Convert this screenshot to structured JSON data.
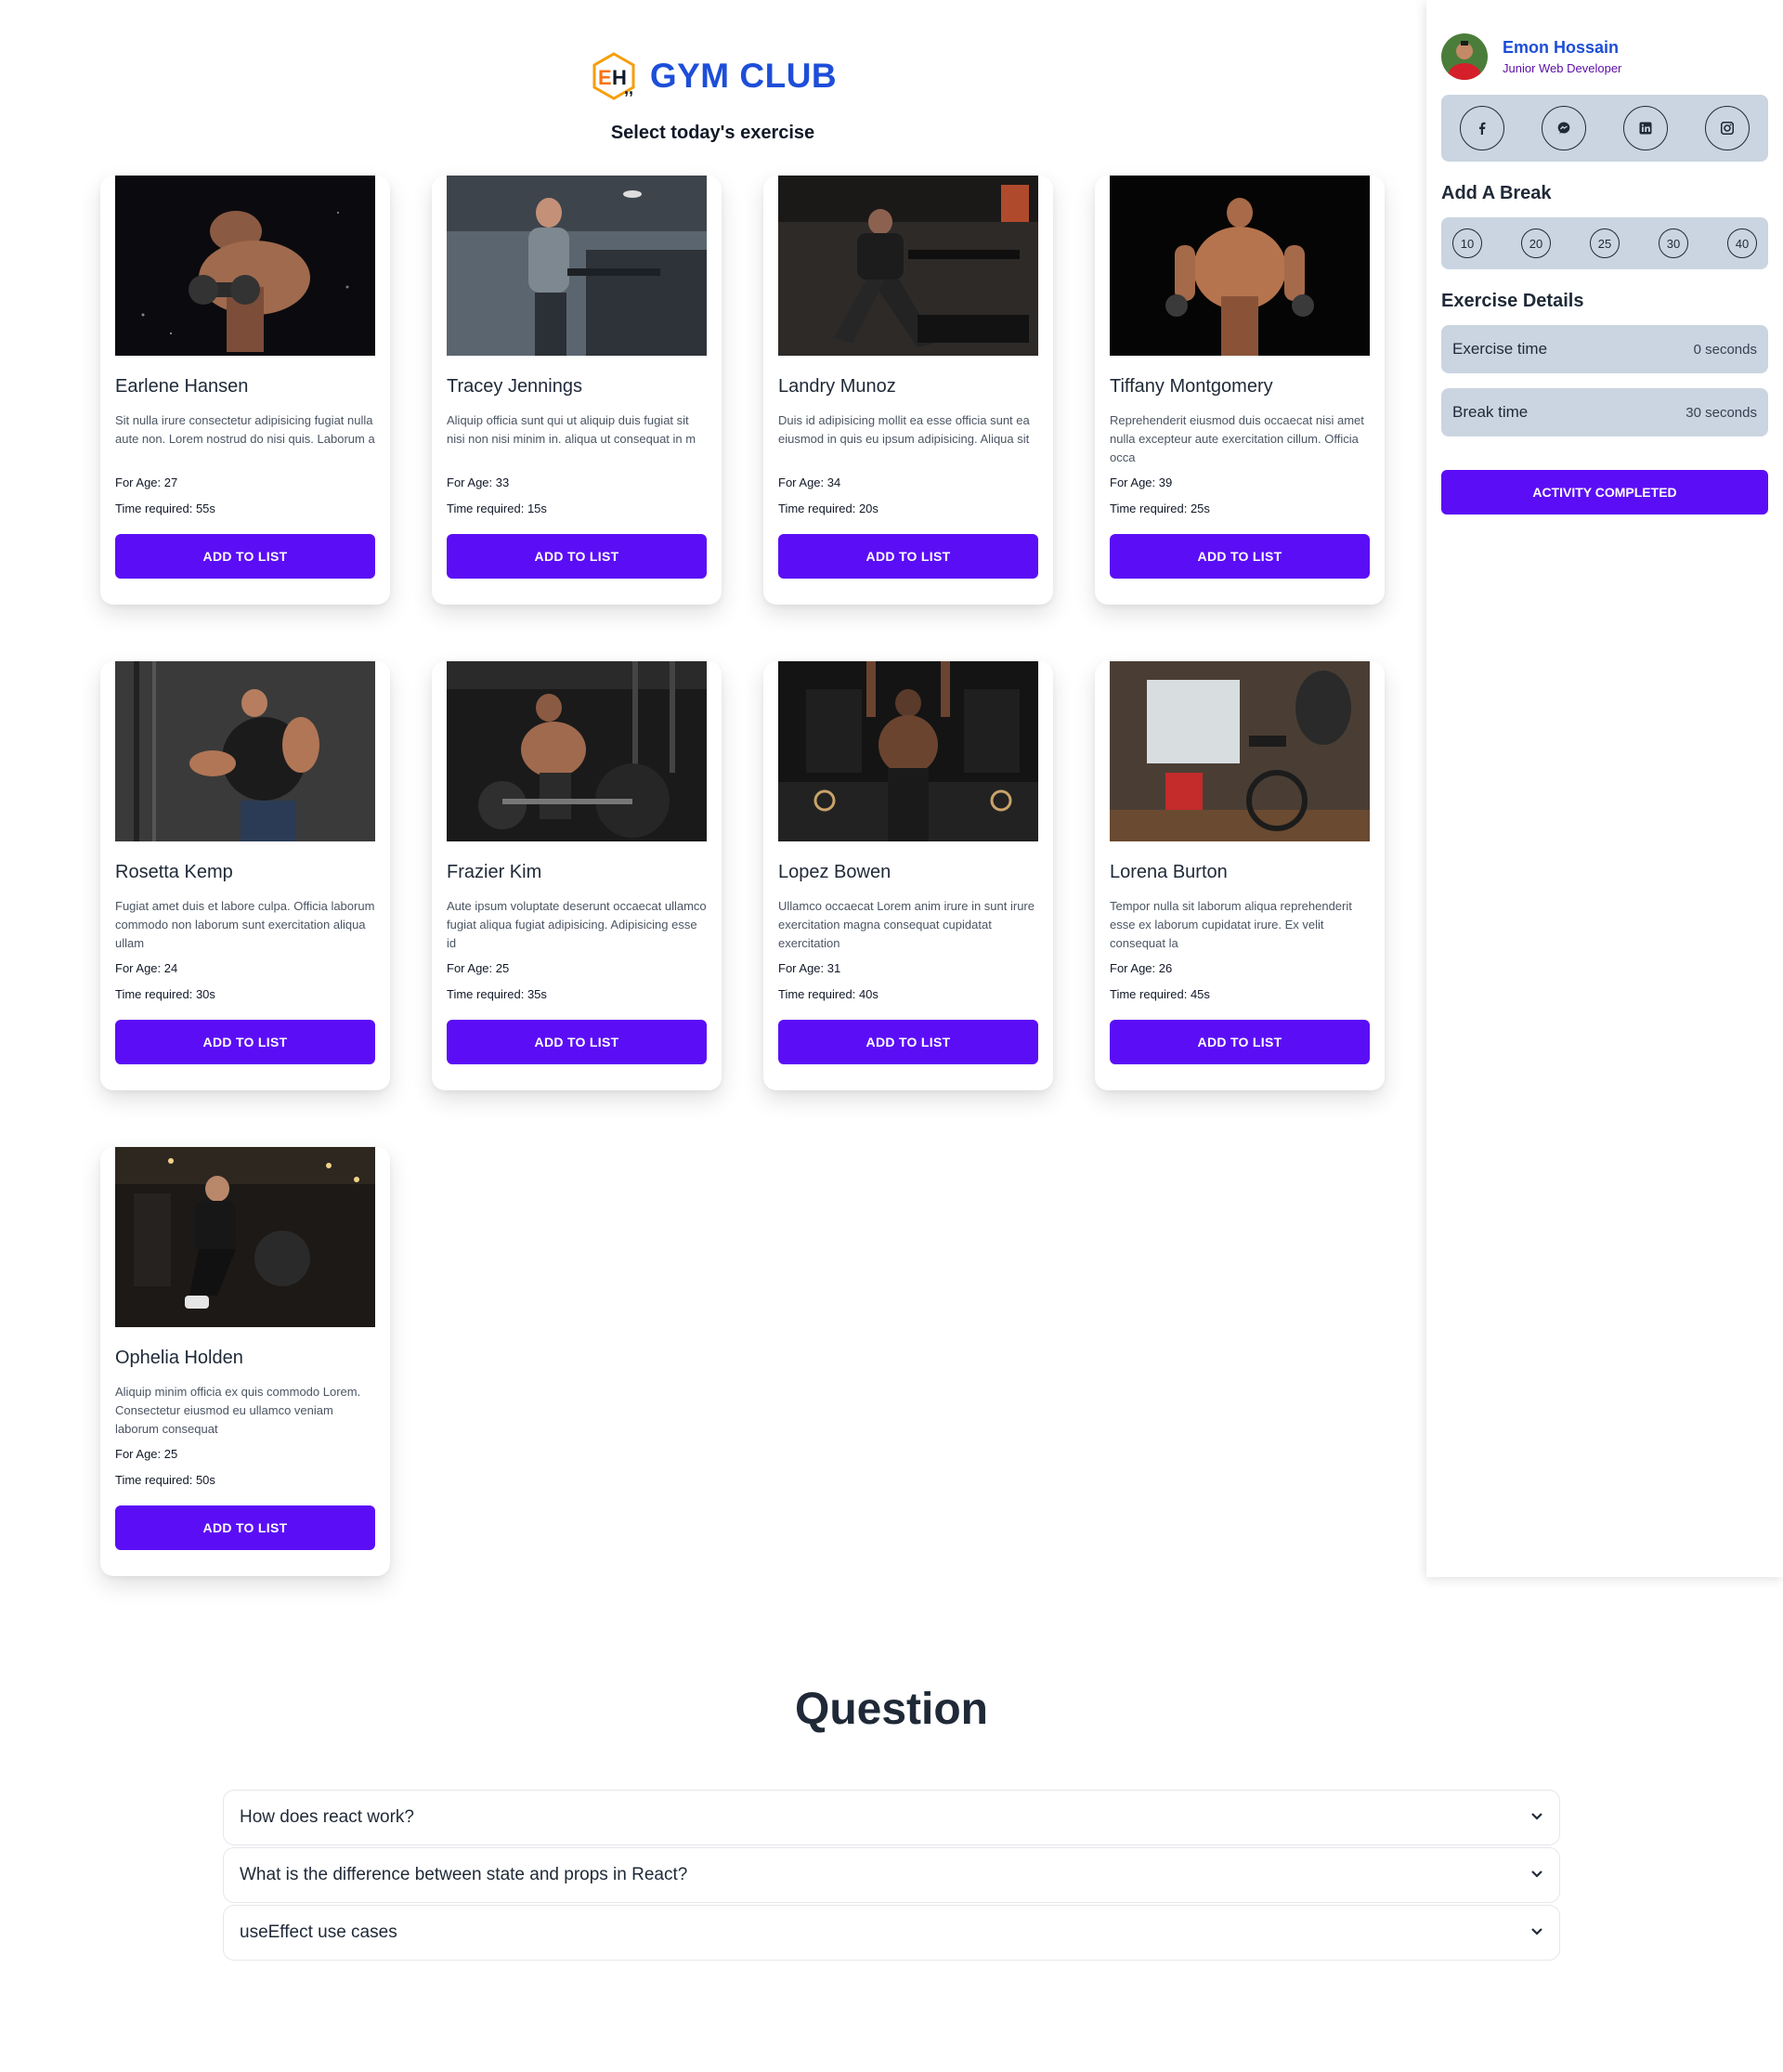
{
  "header": {
    "logo_text": "EH",
    "brand": "GYM CLUB",
    "subtitle": "Select today's exercise"
  },
  "cards": [
    {
      "name": "Earlene Hansen",
      "desc": "Sit nulla irure consectetur adipisicing fugiat nulla aute non. Lorem nostrud do nisi quis. Laborum a",
      "age": "For Age: 27",
      "time": "Time required: 55s",
      "button": "ADD TO LIST"
    },
    {
      "name": "Tracey Jennings",
      "desc": "Aliquip officia sunt qui ut aliquip duis fugiat sit nisi non nisi minim in. aliqua ut consequat in m",
      "age": "For Age: 33",
      "time": "Time required: 15s",
      "button": "ADD TO LIST"
    },
    {
      "name": "Landry Munoz",
      "desc": "Duis id adipisicing mollit ea esse officia sunt ea eiusmod in quis eu ipsum adipisicing. Aliqua sit",
      "age": "For Age: 34",
      "time": "Time required: 20s",
      "button": "ADD TO LIST"
    },
    {
      "name": "Tiffany Montgomery",
      "desc": "Reprehenderit eiusmod duis occaecat nisi amet nulla excepteur aute exercitation cillum. Officia occa",
      "age": "For Age: 39",
      "time": "Time required: 25s",
      "button": "ADD TO LIST"
    },
    {
      "name": "Rosetta Kemp",
      "desc": "Fugiat amet duis et labore culpa. Officia laborum commodo non laborum sunt exercitation aliqua ullam",
      "age": "For Age: 24",
      "time": "Time required: 30s",
      "button": "ADD TO LIST"
    },
    {
      "name": "Frazier Kim",
      "desc": "Aute ipsum voluptate deserunt occaecat ullamco fugiat aliqua fugiat adipisicing. Adipisicing esse id",
      "age": "For Age: 25",
      "time": "Time required: 35s",
      "button": "ADD TO LIST"
    },
    {
      "name": "Lopez Bowen",
      "desc": "Ullamco occaecat Lorem anim irure in sunt irure exercitation magna consequat cupidatat exercitation",
      "age": "For Age: 31",
      "time": "Time required: 40s",
      "button": "ADD TO LIST"
    },
    {
      "name": "Lorena Burton",
      "desc": "Tempor nulla sit laborum aliqua reprehenderit esse ex laborum cupidatat irure. Ex velit consequat la",
      "age": "For Age: 26",
      "time": "Time required: 45s",
      "button": "ADD TO LIST"
    },
    {
      "name": "Ophelia Holden",
      "desc": "Aliquip minim officia ex quis commodo Lorem. Consectetur eiusmod eu ullamco veniam laborum consequat",
      "age": "For Age: 25",
      "time": "Time required: 50s",
      "button": "ADD TO LIST"
    }
  ],
  "sidebar": {
    "name": "Emon Hossain",
    "role": "Junior Web Developer",
    "socials": [
      "facebook-icon",
      "messenger-icon",
      "linkedin-icon",
      "instagram-icon"
    ],
    "break_title": "Add A Break",
    "breaks": [
      "10",
      "20",
      "25",
      "30",
      "40"
    ],
    "details_title": "Exercise Details",
    "exercise_label": "Exercise time",
    "exercise_value": "0 seconds",
    "break_label": "Break time",
    "break_value": "30 seconds",
    "complete_button": "ACTIVITY COMPLETED"
  },
  "questions": {
    "title": "Question",
    "items": [
      "How does react work?",
      "What is the difference between state and props in React?",
      "useEffect use cases"
    ]
  },
  "colors": {
    "accent": "#5b0ef6",
    "brand": "#1d4ed8",
    "panel": "#cbd5e1"
  }
}
